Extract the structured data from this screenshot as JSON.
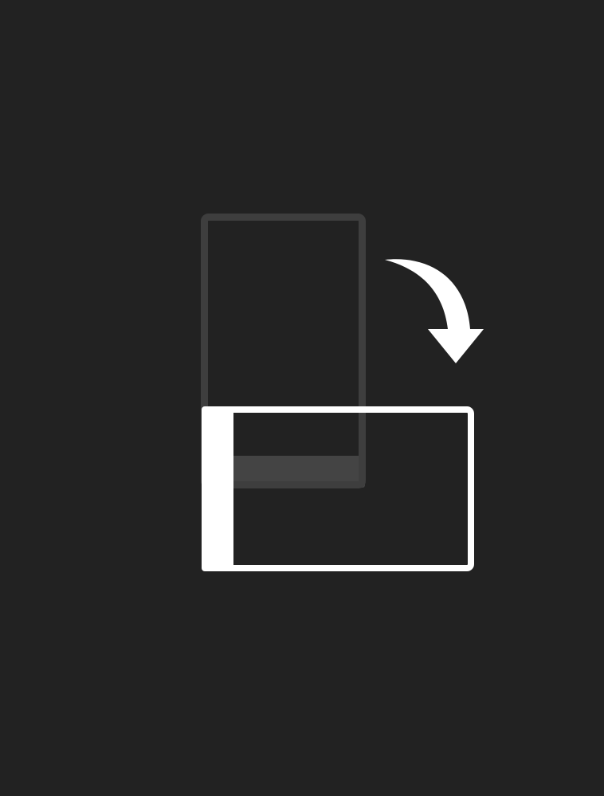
{
  "screen": {
    "background_color": "#222222"
  },
  "illustration": {
    "semantic": "rotate-device-to-landscape",
    "icons": {
      "portrait_device": "portrait-phone-icon",
      "rotation_arrow": "rotate-clockwise-arrow-icon",
      "landscape_device": "landscape-phone-icon"
    },
    "colors": {
      "portrait_outline": "#3e3e3e",
      "portrait_bar": "#444444",
      "landscape_outline": "#ffffff",
      "arrow": "#ffffff"
    }
  }
}
